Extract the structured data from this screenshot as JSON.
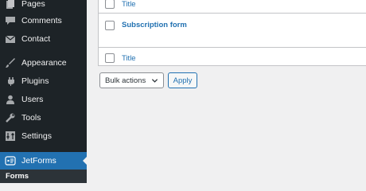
{
  "sidebar": {
    "items": [
      {
        "label": "Pages",
        "icon": "pages-icon"
      },
      {
        "label": "Comments",
        "icon": "comments-icon"
      },
      {
        "label": "Contact",
        "icon": "envelope-icon"
      },
      {
        "label": "Appearance",
        "icon": "paintbrush-icon"
      },
      {
        "label": "Plugins",
        "icon": "plugin-icon"
      },
      {
        "label": "Users",
        "icon": "user-icon"
      },
      {
        "label": "Tools",
        "icon": "wrench-icon"
      },
      {
        "label": "Settings",
        "icon": "settings-icon"
      },
      {
        "label": "JetForms",
        "icon": "jetforms-icon",
        "active": true
      }
    ],
    "submenu_heading": "Forms"
  },
  "table": {
    "column_title": "Title",
    "rows": [
      {
        "title": "Subscription form"
      }
    ]
  },
  "bulk": {
    "select_label": "Bulk actions",
    "apply_label": "Apply"
  },
  "colors": {
    "sidebar_bg": "#1d2327",
    "accent": "#2271b1",
    "page_bg": "#f0f0f1"
  }
}
